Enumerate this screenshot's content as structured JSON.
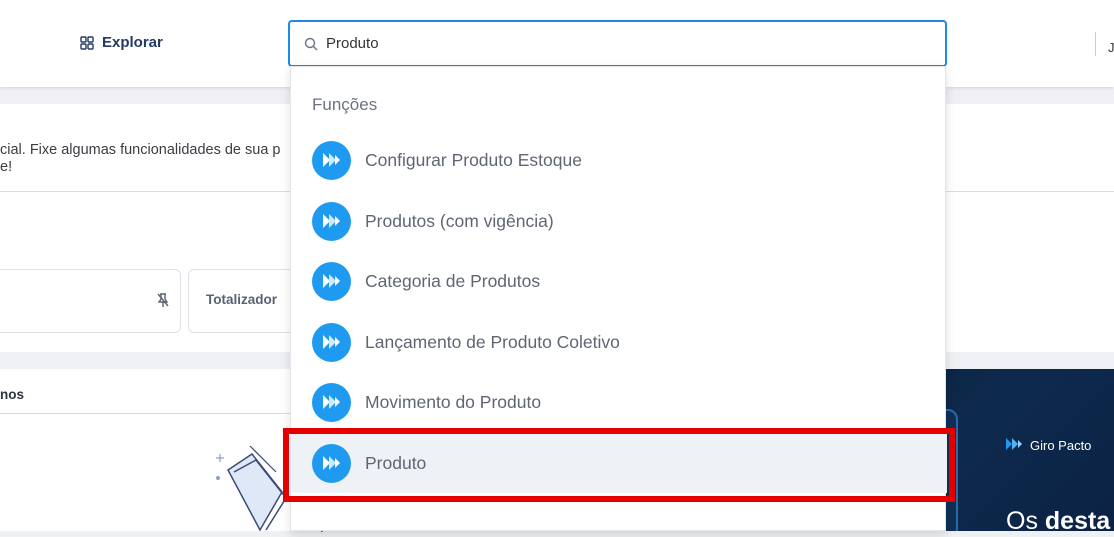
{
  "topbar": {
    "explore_label": "Explorar",
    "edge_glyph": "J"
  },
  "search": {
    "value": "Produto",
    "icon": "search-icon"
  },
  "page": {
    "notice_line1": "cial. Fixe algumas funcionalidades de sua p",
    "notice_line2": "e!",
    "totalizer_label": "Totalizador",
    "section_title": "nos"
  },
  "banner": {
    "brand": "Giro Pacto",
    "headline_prefix": "Os ",
    "headline_bold": "desta"
  },
  "dropdown": {
    "header": "Funções",
    "items": [
      {
        "label": "Configurar Produto Estoque"
      },
      {
        "label": "Produtos (com vigência)"
      },
      {
        "label": "Categoria de Produtos"
      },
      {
        "label": "Lançamento de Produto Coletivo"
      },
      {
        "label": "Movimento do Produto"
      },
      {
        "label": "Produto"
      }
    ],
    "selected_index": 5
  },
  "colors": {
    "accent": "#1e88e5",
    "item_logo": "#1e9bf0",
    "highlight": "#e50000",
    "nav_text": "#243a66"
  }
}
